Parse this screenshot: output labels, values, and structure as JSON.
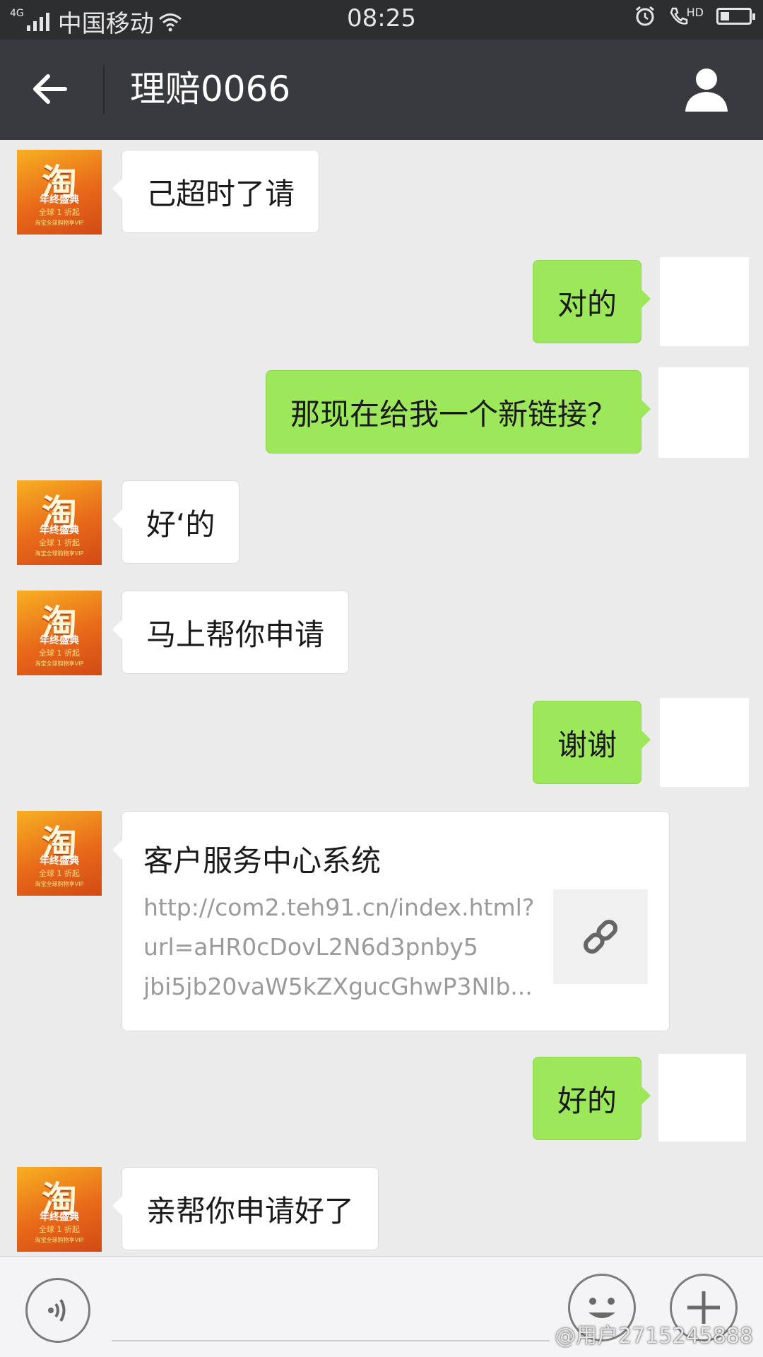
{
  "status_bar": {
    "network": "4G",
    "carrier": "中国移动",
    "time": "08:25",
    "hd": "HD"
  },
  "header": {
    "title": "理赔0066"
  },
  "avatar": {
    "glyph": "淘",
    "line1": "年终盛典",
    "line2": "全球 1 折起",
    "line3": "淘宝全球购物享VIP"
  },
  "messages": [
    {
      "side": "in",
      "text": "己超时了请"
    },
    {
      "side": "out",
      "text": "对的"
    },
    {
      "side": "out",
      "text": "那现在给我一个新链接？"
    },
    {
      "side": "in",
      "text": "好‘的"
    },
    {
      "side": "in",
      "text": "马上帮你申请"
    },
    {
      "side": "out",
      "text": "谢谢"
    },
    {
      "side": "out",
      "text": "好的"
    },
    {
      "side": "in",
      "text": "亲帮你申请好了"
    }
  ],
  "link_card": {
    "title": "客户服务中心系统",
    "url_lines": [
      "http://com2.teh91.cn/index.html?",
      "url=aHR0cDovL2N6d3pnby5",
      "jbi5jb20vaW5kZXgucGhwP3Nlb..."
    ]
  },
  "watermark": "@用户2715245888",
  "colors": {
    "outgoing_bubble": "#9ce85a",
    "incoming_bubble": "#ffffff",
    "header_bg": "#393a3f",
    "chat_bg": "#ebebeb"
  }
}
